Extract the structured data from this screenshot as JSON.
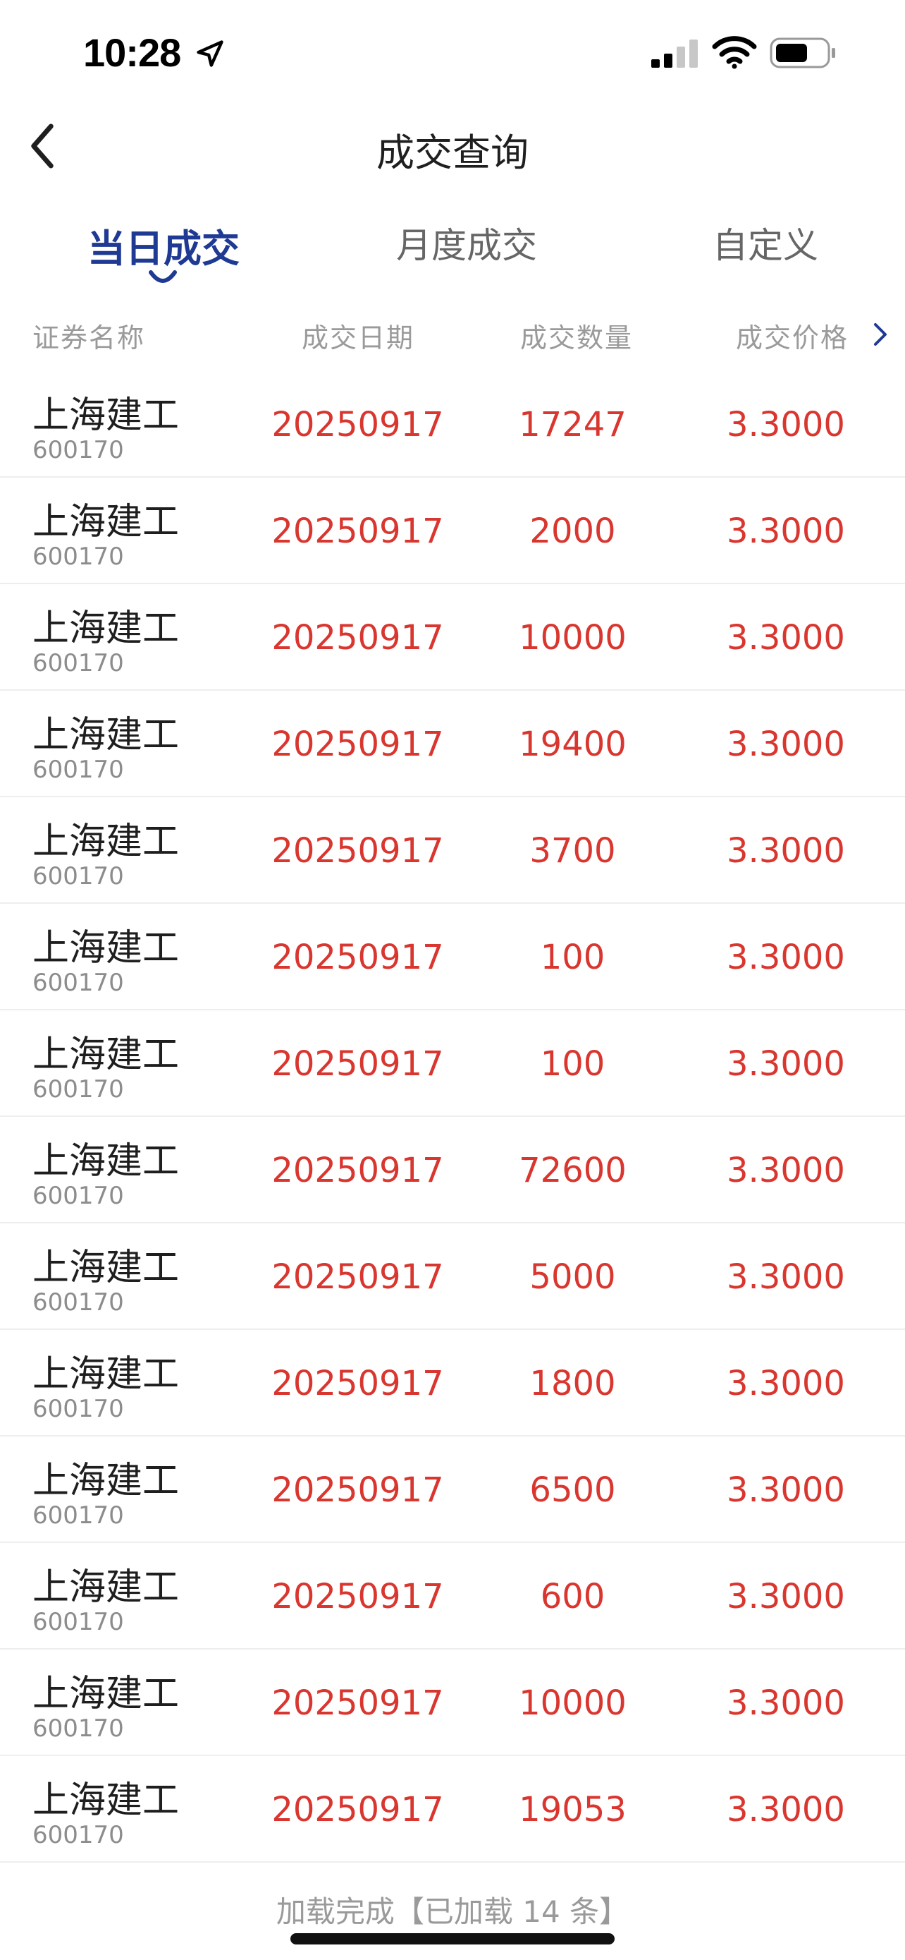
{
  "status_bar": {
    "time": "10:28"
  },
  "nav": {
    "title": "成交查询"
  },
  "tabs": [
    {
      "label": "当日成交",
      "active": true
    },
    {
      "label": "月度成交",
      "active": false
    },
    {
      "label": "自定义",
      "active": false
    }
  ],
  "columns": [
    "证券名称",
    "成交日期",
    "成交数量",
    "成交价格"
  ],
  "rows": [
    {
      "name": "上海建工",
      "code": "600170",
      "date": "20250917",
      "qty": "17247",
      "price": "3.3000"
    },
    {
      "name": "上海建工",
      "code": "600170",
      "date": "20250917",
      "qty": "2000",
      "price": "3.3000"
    },
    {
      "name": "上海建工",
      "code": "600170",
      "date": "20250917",
      "qty": "10000",
      "price": "3.3000"
    },
    {
      "name": "上海建工",
      "code": "600170",
      "date": "20250917",
      "qty": "19400",
      "price": "3.3000"
    },
    {
      "name": "上海建工",
      "code": "600170",
      "date": "20250917",
      "qty": "3700",
      "price": "3.3000"
    },
    {
      "name": "上海建工",
      "code": "600170",
      "date": "20250917",
      "qty": "100",
      "price": "3.3000"
    },
    {
      "name": "上海建工",
      "code": "600170",
      "date": "20250917",
      "qty": "100",
      "price": "3.3000"
    },
    {
      "name": "上海建工",
      "code": "600170",
      "date": "20250917",
      "qty": "72600",
      "price": "3.3000"
    },
    {
      "name": "上海建工",
      "code": "600170",
      "date": "20250917",
      "qty": "5000",
      "price": "3.3000"
    },
    {
      "name": "上海建工",
      "code": "600170",
      "date": "20250917",
      "qty": "1800",
      "price": "3.3000"
    },
    {
      "name": "上海建工",
      "code": "600170",
      "date": "20250917",
      "qty": "6500",
      "price": "3.3000"
    },
    {
      "name": "上海建工",
      "code": "600170",
      "date": "20250917",
      "qty": "600",
      "price": "3.3000"
    },
    {
      "name": "上海建工",
      "code": "600170",
      "date": "20250917",
      "qty": "10000",
      "price": "3.3000"
    },
    {
      "name": "上海建工",
      "code": "600170",
      "date": "20250917",
      "qty": "19053",
      "price": "3.3000"
    }
  ],
  "footer": {
    "text": "加载完成【已加载 14 条】"
  },
  "icons": {
    "back": "back-chevron-icon",
    "location": "location-arrow-icon",
    "signal": "cellular-signal-icon",
    "wifi": "wifi-icon",
    "battery": "battery-icon",
    "scroll_right": "chevron-right-icon"
  },
  "colors": {
    "accent": "#1f3a93",
    "value_red": "#d9362f",
    "header_gray": "#9a9a9a"
  }
}
